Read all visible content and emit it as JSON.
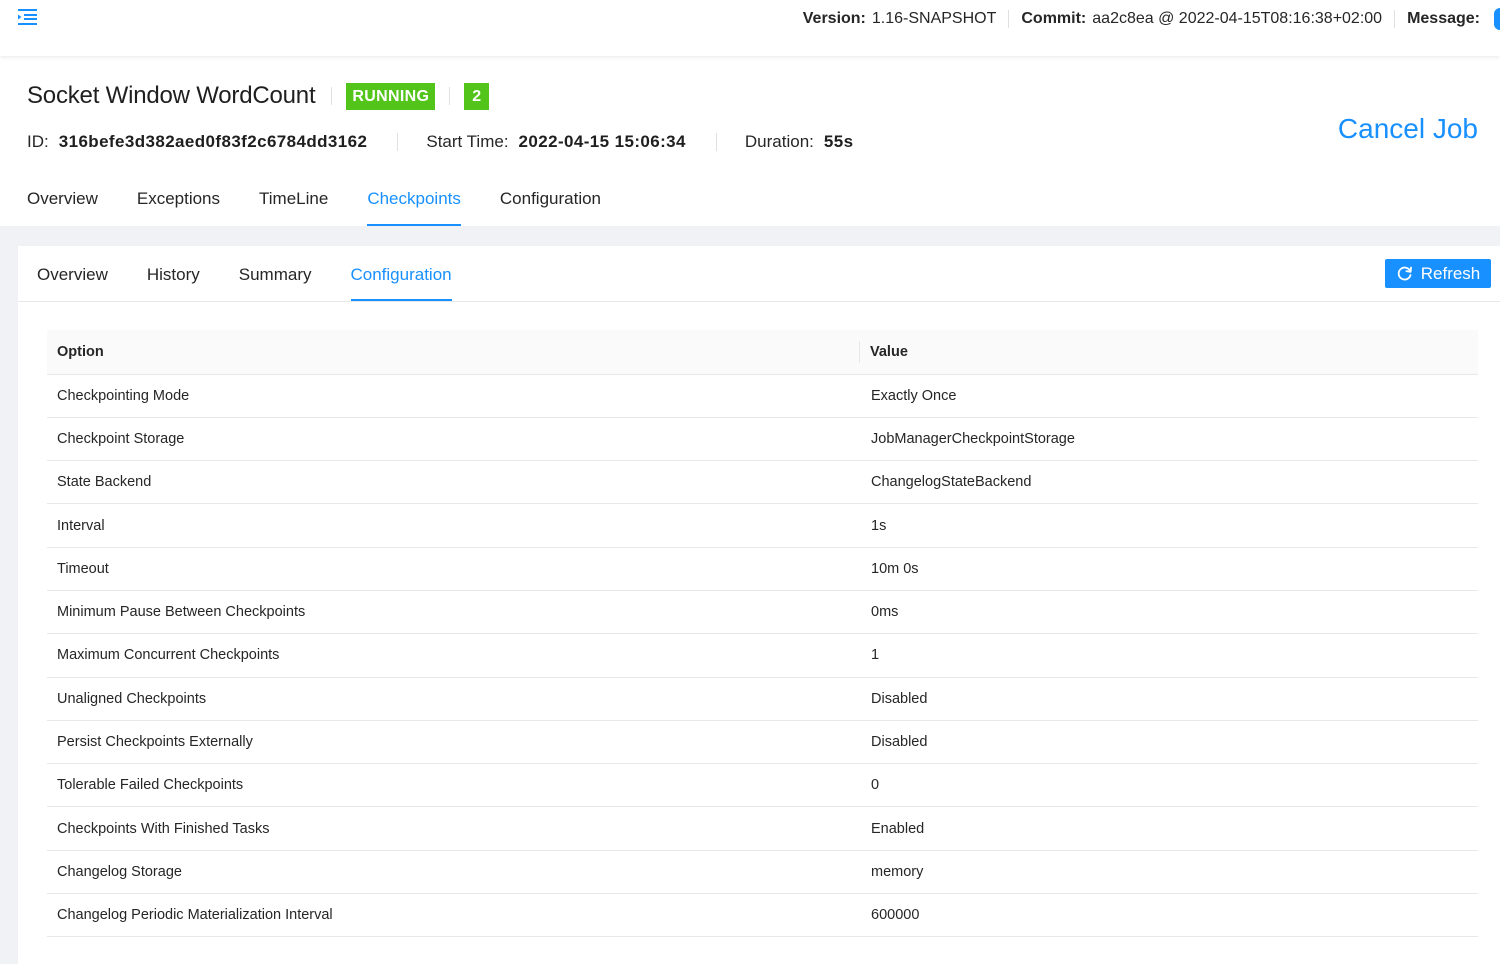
{
  "header": {
    "menu_icon": "menu-fold-icon",
    "version_label": "Version:",
    "version_value": "1.16-SNAPSHOT",
    "commit_label": "Commit:",
    "commit_value": "aa2c8ea @ 2022-04-15T08:16:38+02:00",
    "message_label": "Message:"
  },
  "job": {
    "title": "Socket Window WordCount",
    "status": "RUNNING",
    "count": "2",
    "id_label": "ID:",
    "id_value": "316befe3d382aed0f83f2c6784dd3162",
    "start_label": "Start Time:",
    "start_value": "2022-04-15 15:06:34",
    "duration_label": "Duration:",
    "duration_value": "55s",
    "cancel_label": "Cancel Job"
  },
  "primary_tabs": [
    {
      "label": "Overview"
    },
    {
      "label": "Exceptions"
    },
    {
      "label": "TimeLine"
    },
    {
      "label": "Checkpoints",
      "active": true
    },
    {
      "label": "Configuration"
    }
  ],
  "secondary_tabs": [
    {
      "label": "Overview"
    },
    {
      "label": "History"
    },
    {
      "label": "Summary"
    },
    {
      "label": "Configuration",
      "active": true
    }
  ],
  "refresh_label": "Refresh",
  "colors": {
    "accent": "#1890ff",
    "running": "#52c41a",
    "background": "#f0f2f5"
  },
  "table": {
    "headers": [
      "Option",
      "Value"
    ],
    "rows": [
      [
        "Checkpointing Mode",
        "Exactly Once"
      ],
      [
        "Checkpoint Storage",
        "JobManagerCheckpointStorage"
      ],
      [
        "State Backend",
        "ChangelogStateBackend"
      ],
      [
        "Interval",
        "1s"
      ],
      [
        "Timeout",
        "10m 0s"
      ],
      [
        "Minimum Pause Between Checkpoints",
        "0ms"
      ],
      [
        "Maximum Concurrent Checkpoints",
        "1"
      ],
      [
        "Unaligned Checkpoints",
        "Disabled"
      ],
      [
        "Persist Checkpoints Externally",
        "Disabled"
      ],
      [
        "Tolerable Failed Checkpoints",
        "0"
      ],
      [
        "Checkpoints With Finished Tasks",
        "Enabled"
      ],
      [
        "Changelog Storage",
        "memory"
      ],
      [
        "Changelog Periodic Materialization Interval",
        "600000"
      ]
    ]
  }
}
